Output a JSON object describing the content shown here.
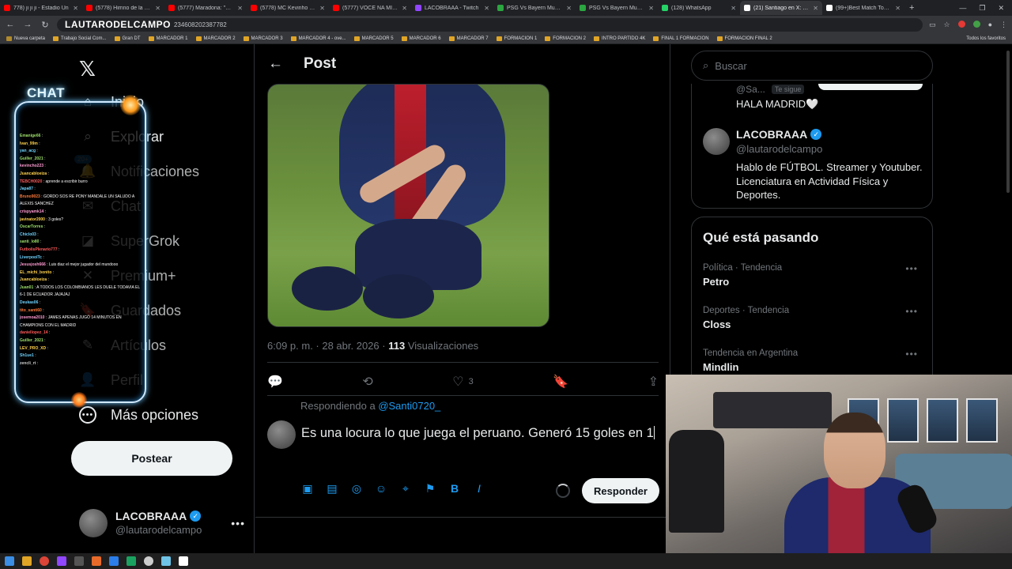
{
  "browser": {
    "tabs": [
      {
        "label": "778) ji ji ji - Estadio Ún",
        "color": "#ff0000",
        "active": false
      },
      {
        "label": "(5778) Himno de la cham",
        "color": "#ff0000",
        "active": false
      },
      {
        "label": "(5777) Maradona: \"A jug",
        "color": "#ff0000",
        "active": false
      },
      {
        "label": "(5778) MC Kevinho - O G",
        "color": "#ff0000",
        "active": false
      },
      {
        "label": "(5777) VOCE NA MIRA (s",
        "color": "#ff0000",
        "active": false
      },
      {
        "label": "LACOBRAAA - Twitch",
        "color": "#9146ff",
        "active": false
      },
      {
        "label": "PSG Vs Bayern Munich - ",
        "color": "#2ba640",
        "active": false
      },
      {
        "label": "PSG Vs Bayern Munich - ",
        "color": "#2ba640",
        "active": false
      },
      {
        "label": "(128) WhatsApp",
        "color": "#25d366",
        "active": false
      },
      {
        "label": "(21) Santiago en X: \"@la",
        "color": "#ffffff",
        "active": true
      },
      {
        "label": "(99+)Best Match Today",
        "color": "#ffffff",
        "active": false
      }
    ],
    "new_tab": "+",
    "url": "234608202387782",
    "bookmarks": [
      "Nueva carpeta",
      "Trabajo Social Com...",
      "Gran DT",
      "MARCADOR 1",
      "MARCADOR 2",
      "MARCADOR 3",
      "MARCADOR 4 - ove...",
      "MARCADOR 5",
      "MARCADOR 6",
      "MARCADOR 7",
      "FORMACION 1",
      "FORMACION 2",
      "INTRO PARTIDO 4K",
      "FINAL 1 FORMACION",
      "FORMACION FINAL 2"
    ],
    "bookmarks_right": "Todos los favoritos"
  },
  "stream_overlay": {
    "channel_name": "LAUTARODELCAMPO",
    "chat_title": "CHAT",
    "chat_lines": [
      {
        "user": "Emanige66",
        "text": ":",
        "color": "#9ee06b"
      },
      {
        "user": "Ivan_99m",
        "text": ":",
        "color": "#ffd24d"
      },
      {
        "user": "yan_acg",
        "text": ":",
        "color": "#6fd3ff"
      },
      {
        "user": "Guiller_2021",
        "text": ":",
        "color": "#9ee06b"
      },
      {
        "user": "kevincho223",
        "text": ":",
        "color": "#ff9bd2"
      },
      {
        "user": "Juancabloeiza",
        "text": ":",
        "color": "#ffd24d"
      },
      {
        "user": "TEBCH0020",
        "text": ": aprende a escribir burro",
        "color": "#ff5a5a"
      },
      {
        "user": "Japa87",
        "text": ":",
        "color": "#6fd3ff"
      },
      {
        "user": "Bruno9023",
        "text": ": GORDO SOS RE PONY MANDALE UN SALUDO A",
        "color": "#ff7a3a"
      },
      {
        "user": "",
        "text": "ALEXIS SANCHEZ",
        "color": "#ffffff"
      },
      {
        "user": "crispyamk14",
        "text": ":",
        "color": "#ff9bd2"
      },
      {
        "user": "javinator2000",
        "text": ": 3 goles?",
        "color": "#ffd24d"
      },
      {
        "user": "OscarTorres",
        "text": ":",
        "color": "#9ee06b"
      },
      {
        "user": "Chiclo03",
        "text": ":",
        "color": "#6fd3ff"
      },
      {
        "user": "santi_lo80",
        "text": ":",
        "color": "#9ee06b"
      },
      {
        "user": "FutbolisPlenario777",
        "text": ":",
        "color": "#ff5a5a"
      },
      {
        "user": "LiverpoolTc",
        "text": ":",
        "color": "#6fd3ff"
      },
      {
        "user": "Jesusjosh666",
        "text": ": Luis diaz el mejor jugador del mundooo",
        "color": "#ff9bd2"
      },
      {
        "user": "EL_michi_bonito",
        "text": ":",
        "color": "#ffd24d"
      },
      {
        "user": "Juancabloeiza",
        "text": ":",
        "color": "#ffd24d"
      },
      {
        "user": "Juan01",
        "text": ": A TODOS LOS COLOMBIANOS LES DUELE TODAVIA EL",
        "color": "#9ee06b"
      },
      {
        "user": "",
        "text": "6-1 DE ECUADOR JAJAJAJ",
        "color": "#ffffff"
      },
      {
        "user": "Deukas06",
        "text": ":",
        "color": "#6fd3ff"
      },
      {
        "user": "tito_santi60",
        "text": ":",
        "color": "#ff7a3a"
      },
      {
        "user": "josemoa2010",
        "text": ": JAMES APENAS JUGÓ 14 MINUTOS EN",
        "color": "#ff9bd2"
      },
      {
        "user": "",
        "text": "CHAMPIONS CON EL MADRID",
        "color": "#ffffff"
      },
      {
        "user": "daniellopez_14",
        "text": ":",
        "color": "#ff5a5a"
      },
      {
        "user": "Guiller_2021",
        "text": ":",
        "color": "#9ee06b"
      },
      {
        "user": "LEV_PRO_XD",
        "text": ":",
        "color": "#ffd24d"
      },
      {
        "user": "Sh1ue1",
        "text": ":",
        "color": "#6fd3ff"
      },
      {
        "user": "zencli_rt",
        "text": ":",
        "color": "#cccccc"
      }
    ]
  },
  "left_nav": {
    "items": [
      {
        "label": "Inicio",
        "icon": "home-icon",
        "glyph": "⌂"
      },
      {
        "label": "Explorar",
        "icon": "search-icon",
        "glyph": "⌕"
      },
      {
        "label": "Notificaciones",
        "icon": "bell-icon",
        "glyph": "🔔"
      },
      {
        "label": "Chat",
        "icon": "chat-icon",
        "glyph": "✉"
      },
      {
        "label": "SuperGrok",
        "icon": "grok-icon",
        "glyph": "◪"
      },
      {
        "label": "Premium+",
        "icon": "premium-icon",
        "glyph": "✕"
      },
      {
        "label": "Guardados",
        "icon": "bookmark-icon",
        "glyph": "🔖"
      },
      {
        "label": "Artículos",
        "icon": "article-icon",
        "glyph": "✎"
      },
      {
        "label": "Perfil",
        "icon": "profile-icon",
        "glyph": "👤"
      },
      {
        "label": "Más opciones",
        "icon": "more-options-icon",
        "glyph": "•••"
      }
    ],
    "notif_badge": "20+",
    "post_button": "Postear",
    "account": {
      "name": "LACOBRAAA",
      "handle": "@lautarodelcampo",
      "more": "•••"
    }
  },
  "post": {
    "header_title": "Post",
    "timestamp": "6:09 p. m. · 28 abr. 2026 · ",
    "views_count": "113",
    "views_label": "Visualizaciones",
    "actions": {
      "likes": "3"
    },
    "replying_prefix": "Respondiendo a ",
    "replying_handle": "@Santi0720_",
    "reply_text": "Es una locura lo que juega el peruano. Generó 15 goles en 1",
    "reply_button": "Responder"
  },
  "right_col": {
    "search_placeholder": "Buscar",
    "prev_user_handle": "@Sa...",
    "follows_you": "Te sigue",
    "prev_user_text": "HALA MADRID🤍",
    "card": {
      "name": "LACOBRAAA",
      "handle": "@lautarodelcampo",
      "bio": "Hablo de FÚTBOL. Streamer y Youtuber. Licenciatura en Actividad Física y Deportes."
    },
    "trends_title": "Qué está pasando",
    "trends": [
      {
        "meta": "Política · Tendencia",
        "name": "Petro"
      },
      {
        "meta": "Deportes · Tendencia",
        "name": "Closs"
      },
      {
        "meta": "Tendencia en Argentina",
        "name": "Mindlin"
      }
    ]
  }
}
